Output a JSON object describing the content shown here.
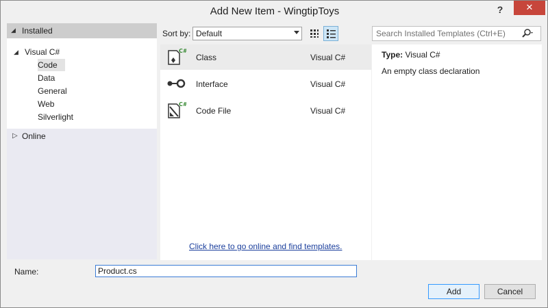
{
  "window": {
    "title": "Add New Item - WingtipToys",
    "help_label": "?",
    "close_label": "✕"
  },
  "tree": {
    "installed_label": "Installed",
    "visual_csharp_label": "Visual C#",
    "children": [
      "Code",
      "Data",
      "General",
      "Web",
      "Silverlight"
    ],
    "selected": "Code",
    "online_label": "Online"
  },
  "toolbar": {
    "sort_label": "Sort by:",
    "sort_value": "Default",
    "search_placeholder": "Search Installed Templates (Ctrl+E)"
  },
  "templates": [
    {
      "name": "Class",
      "lang": "Visual C#",
      "icon": "class-icon",
      "selected": true
    },
    {
      "name": "Interface",
      "lang": "Visual C#",
      "icon": "interface-icon",
      "selected": false
    },
    {
      "name": "Code File",
      "lang": "Visual C#",
      "icon": "code-file-icon",
      "selected": false
    }
  ],
  "online_link": "Click here to go online and find templates.",
  "detail": {
    "type_label": "Type:",
    "type_value": "Visual C#",
    "description": "An empty class declaration"
  },
  "form": {
    "name_label": "Name:",
    "name_value": "Product.cs",
    "add_label": "Add",
    "cancel_label": "Cancel"
  }
}
